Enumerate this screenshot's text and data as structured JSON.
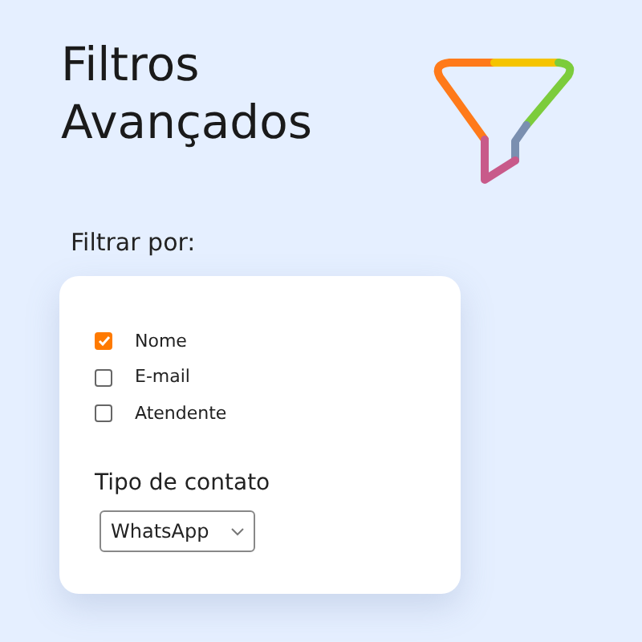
{
  "title": "Filtros Avançados",
  "filter_label": "Filtrar por:",
  "options": [
    {
      "label": "Nome",
      "checked": true
    },
    {
      "label": "E-mail",
      "checked": false
    },
    {
      "label": "Atendente",
      "checked": false
    }
  ],
  "contact_type": {
    "label": "Tipo de contato",
    "value": "WhatsApp"
  }
}
